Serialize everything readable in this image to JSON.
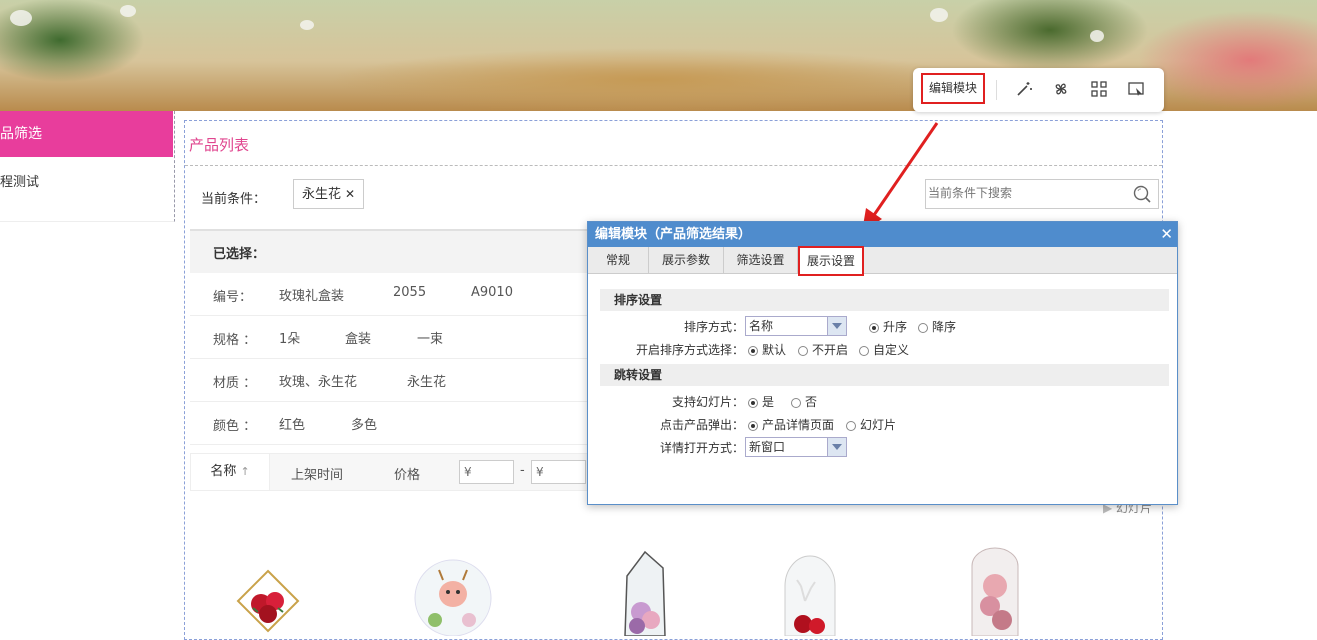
{
  "toolbar": {
    "edit_label": "编辑模块"
  },
  "leftnav": {
    "active_label": "品筛选",
    "item_label": "程测试"
  },
  "module": {
    "title": "产品列表",
    "condition_label": "当前条件：",
    "condition_tag": "永生花",
    "search_placeholder": "当前条件下搜索",
    "selected_label": "已选择："
  },
  "filters": [
    {
      "label": "编号：",
      "options": [
        "玫瑰礼盒装",
        "2055",
        "A9010"
      ]
    },
    {
      "label": "规格 ：",
      "options": [
        "1朵",
        "盒装",
        "一束"
      ]
    },
    {
      "label": "材质 ：",
      "options": [
        "玫瑰、永生花",
        "永生花"
      ]
    },
    {
      "label": "颜色 ：",
      "options": [
        "红色",
        "多色"
      ]
    }
  ],
  "sort": {
    "active": "名称",
    "time": "上架时间",
    "price": "价格",
    "price_prefix": "¥",
    "dash": "-",
    "slideshow": "幻灯片"
  },
  "dialog": {
    "title": "编辑模块（产品筛选结果）",
    "close": "✕",
    "tabs": [
      "常规",
      "展示参数",
      "筛选设置",
      "展示设置"
    ],
    "section1": "排序设置",
    "sort_mode_label": "排序方式：",
    "sort_mode_value": "名称",
    "asc": "升序",
    "desc": "降序",
    "sort_select_label": "开启排序方式选择：",
    "opt_default": "默认",
    "opt_off": "不开启",
    "opt_custom": "自定义",
    "section2": "跳转设置",
    "slide_label": "支持幻灯片：",
    "yes": "是",
    "no": "否",
    "click_label": "点击产品弹出：",
    "click_detail": "产品详情页面",
    "click_slide": "幻灯片",
    "open_label": "详情打开方式：",
    "open_value": "新窗口"
  },
  "colors": {
    "accent": "#e83d9c",
    "dialog_title": "#4f8ccd",
    "highlight": "#e02020"
  }
}
